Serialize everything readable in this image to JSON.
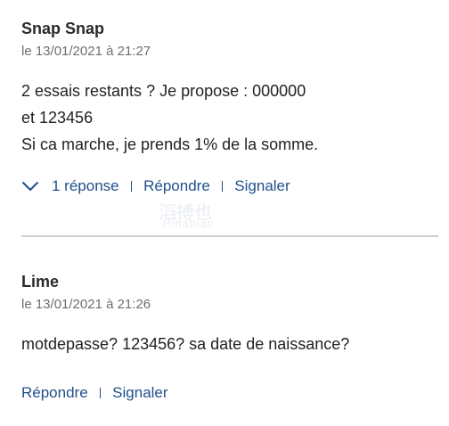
{
  "comments": [
    {
      "author": "Snap Snap",
      "date": "le 13/01/2021 à 21:27",
      "lines": [
        "2 essais restants ? Je propose : 000000",
        "et 123456",
        "Si ca marche, je prends 1% de la somme."
      ],
      "replies_label": "1 réponse",
      "reply_label": "Répondre",
      "report_label": "Signaler"
    },
    {
      "author": "Lime",
      "date": "le 13/01/2021 à 21:26",
      "lines": [
        "motdepasse? 123456? sa date de naissance?"
      ],
      "reply_label": "Répondre",
      "report_label": "Signaler"
    }
  ],
  "watermark": {
    "cn": "滔搏也",
    "latin": "Hinablan"
  },
  "colors": {
    "link": "#1f4f8a",
    "text": "#222222",
    "meta": "#6f6f6f",
    "divider": "#cfcfcf"
  }
}
